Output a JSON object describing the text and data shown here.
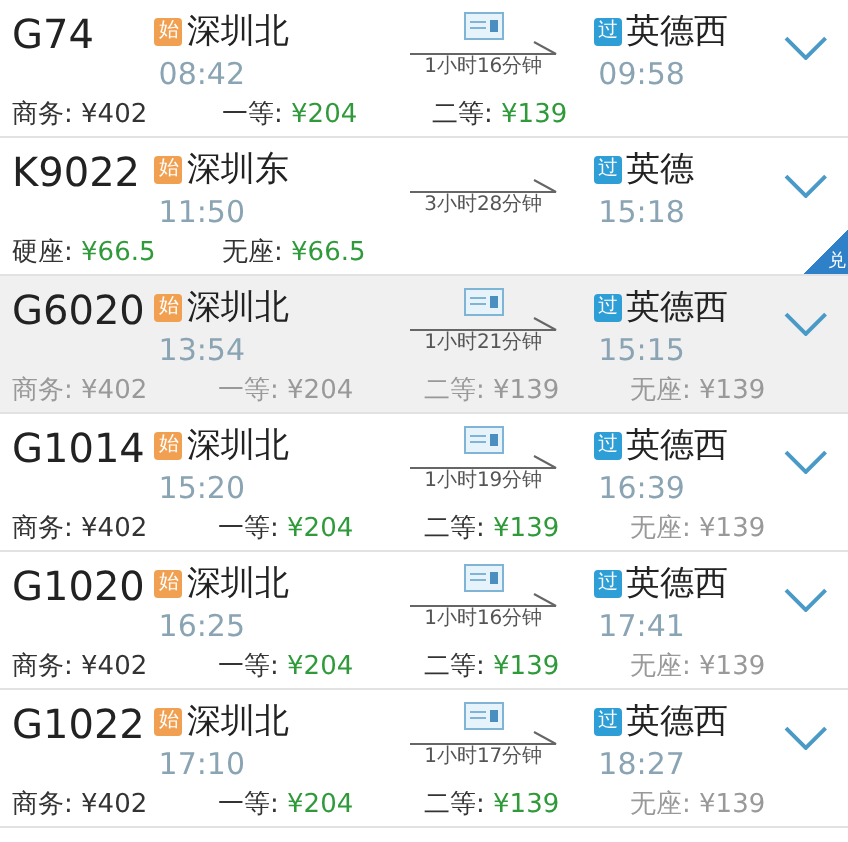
{
  "trains": [
    {
      "number": "G74",
      "selected": false,
      "ticket_icon": true,
      "from": {
        "badge": "始",
        "kind": "start",
        "station": "深圳北",
        "time": "08:42"
      },
      "duration": "1小时16分钟",
      "to": {
        "badge": "过",
        "kind": "pass",
        "station": "英德西",
        "time": "09:58"
      },
      "prices": [
        {
          "label": "商务:",
          "value": "¥402",
          "available": false,
          "disabled": false
        },
        {
          "label": "一等:",
          "value": "¥204",
          "available": true,
          "disabled": false
        },
        {
          "label": "二等:",
          "value": "¥139",
          "available": true,
          "disabled": false
        }
      ]
    },
    {
      "number": "K9022",
      "selected": false,
      "ticket_icon": false,
      "from": {
        "badge": "始",
        "kind": "start",
        "station": "深圳东",
        "time": "11:50"
      },
      "duration": "3小时28分钟",
      "to": {
        "badge": "过",
        "kind": "pass",
        "station": "英德",
        "time": "15:18"
      },
      "corner": "兑",
      "prices": [
        {
          "label": "硬座:",
          "value": "¥66.5",
          "available": true,
          "disabled": false
        },
        {
          "label": "无座:",
          "value": "¥66.5",
          "available": true,
          "disabled": false
        }
      ]
    },
    {
      "number": "G6020",
      "selected": true,
      "ticket_icon": true,
      "from": {
        "badge": "始",
        "kind": "start",
        "station": "深圳北",
        "time": "13:54"
      },
      "duration": "1小时21分钟",
      "to": {
        "badge": "过",
        "kind": "pass",
        "station": "英德西",
        "time": "15:15"
      },
      "prices": [
        {
          "label": "商务:",
          "value": "¥402",
          "available": false,
          "disabled": true
        },
        {
          "label": "一等:",
          "value": "¥204",
          "available": false,
          "disabled": true
        },
        {
          "label": "二等:",
          "value": "¥139",
          "available": false,
          "disabled": true
        },
        {
          "label": "无座:",
          "value": "¥139",
          "available": false,
          "disabled": true
        }
      ]
    },
    {
      "number": "G1014",
      "selected": false,
      "ticket_icon": true,
      "from": {
        "badge": "始",
        "kind": "start",
        "station": "深圳北",
        "time": "15:20"
      },
      "duration": "1小时19分钟",
      "to": {
        "badge": "过",
        "kind": "pass",
        "station": "英德西",
        "time": "16:39"
      },
      "prices": [
        {
          "label": "商务:",
          "value": "¥402",
          "available": false,
          "disabled": false
        },
        {
          "label": "一等:",
          "value": "¥204",
          "available": true,
          "disabled": false
        },
        {
          "label": "二等:",
          "value": "¥139",
          "available": true,
          "disabled": false
        },
        {
          "label": "无座:",
          "value": "¥139",
          "available": false,
          "disabled": true
        }
      ]
    },
    {
      "number": "G1020",
      "selected": false,
      "ticket_icon": true,
      "from": {
        "badge": "始",
        "kind": "start",
        "station": "深圳北",
        "time": "16:25"
      },
      "duration": "1小时16分钟",
      "to": {
        "badge": "过",
        "kind": "pass",
        "station": "英德西",
        "time": "17:41"
      },
      "prices": [
        {
          "label": "商务:",
          "value": "¥402",
          "available": false,
          "disabled": false
        },
        {
          "label": "一等:",
          "value": "¥204",
          "available": true,
          "disabled": false
        },
        {
          "label": "二等:",
          "value": "¥139",
          "available": true,
          "disabled": false
        },
        {
          "label": "无座:",
          "value": "¥139",
          "available": false,
          "disabled": true
        }
      ]
    },
    {
      "number": "G1022",
      "selected": false,
      "ticket_icon": true,
      "from": {
        "badge": "始",
        "kind": "start",
        "station": "深圳北",
        "time": "17:10"
      },
      "duration": "1小时17分钟",
      "to": {
        "badge": "过",
        "kind": "pass",
        "station": "英德西",
        "time": "18:27"
      },
      "prices": [
        {
          "label": "商务:",
          "value": "¥402",
          "available": false,
          "disabled": false
        },
        {
          "label": "一等:",
          "value": "¥204",
          "available": true,
          "disabled": false
        },
        {
          "label": "二等:",
          "value": "¥139",
          "available": true,
          "disabled": false
        },
        {
          "label": "无座:",
          "value": "¥139",
          "available": false,
          "disabled": true
        }
      ]
    }
  ]
}
